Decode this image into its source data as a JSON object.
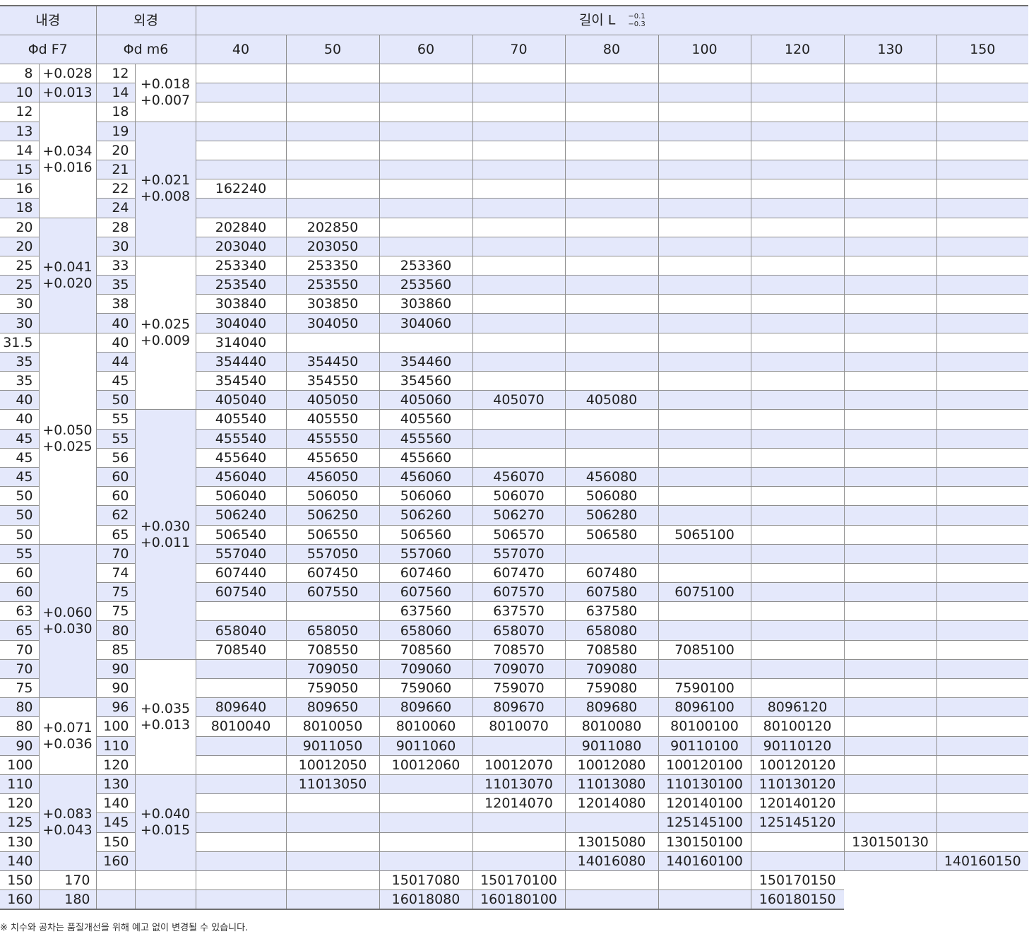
{
  "header": {
    "inner_title": "내경",
    "outer_title": "외경",
    "length_title": "길이 L",
    "length_tol_upper": "−0.1",
    "length_tol_lower": "−0.3",
    "inner_sub": "Φd F7",
    "outer_sub": "Φd m6",
    "lengths": [
      "40",
      "50",
      "60",
      "70",
      "80",
      "100",
      "120",
      "130",
      "150"
    ]
  },
  "inner_tol_groups": [
    {
      "start": 0,
      "span": 1,
      "tol": "+0.028"
    },
    {
      "start": 1,
      "span": 1,
      "tol": "+0.013"
    },
    {
      "start": 2,
      "span": 6,
      "tol": "+0.034\n+0.016"
    },
    {
      "start": 8,
      "span": 6,
      "tol": "+0.041\n+0.020"
    },
    {
      "start": 14,
      "span": 11,
      "tol": "+0.050\n+0.025"
    },
    {
      "start": 25,
      "span": 8,
      "tol": "+0.060\n+0.030"
    },
    {
      "start": 33,
      "span": 4,
      "tol": "+0.071\n+0.036"
    },
    {
      "start": 37,
      "span": 5,
      "tol": "+0.083\n+0.043"
    }
  ],
  "outer_tol_groups": [
    {
      "start": 0,
      "span": 3,
      "tol": "+0.018\n+0.007"
    },
    {
      "start": 3,
      "span": 7,
      "tol": "+0.021\n+0.008"
    },
    {
      "start": 10,
      "span": 8,
      "tol": "+0.025\n+0.009"
    },
    {
      "start": 18,
      "span": 13,
      "tol": "+0.030\n+0.011"
    },
    {
      "start": 31,
      "span": 6,
      "tol": "+0.035\n+0.013"
    },
    {
      "start": 37,
      "span": 5,
      "tol": "+0.040\n+0.015"
    }
  ],
  "rows": [
    {
      "id": "8",
      "od": "12",
      "v": [
        "",
        "",
        "",
        "",
        "",
        "",
        "",
        "",
        ""
      ]
    },
    {
      "id": "10",
      "od": "14",
      "v": [
        "",
        "",
        "",
        "",
        "",
        "",
        "",
        "",
        ""
      ]
    },
    {
      "id": "12",
      "od": "18",
      "v": [
        "",
        "",
        "",
        "",
        "",
        "",
        "",
        "",
        ""
      ]
    },
    {
      "id": "13",
      "od": "19",
      "v": [
        "",
        "",
        "",
        "",
        "",
        "",
        "",
        "",
        ""
      ]
    },
    {
      "id": "14",
      "od": "20",
      "v": [
        "",
        "",
        "",
        "",
        "",
        "",
        "",
        "",
        ""
      ]
    },
    {
      "id": "15",
      "od": "21",
      "v": [
        "",
        "",
        "",
        "",
        "",
        "",
        "",
        "",
        ""
      ]
    },
    {
      "id": "16",
      "od": "22",
      "v": [
        "162240",
        "",
        "",
        "",
        "",
        "",
        "",
        "",
        ""
      ]
    },
    {
      "id": "18",
      "od": "24",
      "v": [
        "",
        "",
        "",
        "",
        "",
        "",
        "",
        "",
        ""
      ]
    },
    {
      "id": "20",
      "od": "28",
      "v": [
        "202840",
        "202850",
        "",
        "",
        "",
        "",
        "",
        "",
        ""
      ]
    },
    {
      "id": "20",
      "od": "30",
      "v": [
        "203040",
        "203050",
        "",
        "",
        "",
        "",
        "",
        "",
        ""
      ]
    },
    {
      "id": "25",
      "od": "33",
      "v": [
        "253340",
        "253350",
        "253360",
        "",
        "",
        "",
        "",
        "",
        ""
      ]
    },
    {
      "id": "25",
      "od": "35",
      "v": [
        "253540",
        "253550",
        "253560",
        "",
        "",
        "",
        "",
        "",
        ""
      ]
    },
    {
      "id": "30",
      "od": "38",
      "v": [
        "303840",
        "303850",
        "303860",
        "",
        "",
        "",
        "",
        "",
        ""
      ]
    },
    {
      "id": "30",
      "od": "40",
      "v": [
        "304040",
        "304050",
        "304060",
        "",
        "",
        "",
        "",
        "",
        ""
      ]
    },
    {
      "id": "31.5",
      "od": "40",
      "v": [
        "314040",
        "",
        "",
        "",
        "",
        "",
        "",
        "",
        ""
      ]
    },
    {
      "id": "35",
      "od": "44",
      "v": [
        "354440",
        "354450",
        "354460",
        "",
        "",
        "",
        "",
        "",
        ""
      ]
    },
    {
      "id": "35",
      "od": "45",
      "v": [
        "354540",
        "354550",
        "354560",
        "",
        "",
        "",
        "",
        "",
        ""
      ]
    },
    {
      "id": "40",
      "od": "50",
      "v": [
        "405040",
        "405050",
        "405060",
        "405070",
        "405080",
        "",
        "",
        "",
        ""
      ]
    },
    {
      "id": "40",
      "od": "55",
      "v": [
        "405540",
        "405550",
        "405560",
        "",
        "",
        "",
        "",
        "",
        ""
      ]
    },
    {
      "id": "45",
      "od": "55",
      "v": [
        "455540",
        "455550",
        "455560",
        "",
        "",
        "",
        "",
        "",
        ""
      ]
    },
    {
      "id": "45",
      "od": "56",
      "v": [
        "455640",
        "455650",
        "455660",
        "",
        "",
        "",
        "",
        "",
        ""
      ]
    },
    {
      "id": "45",
      "od": "60",
      "v": [
        "456040",
        "456050",
        "456060",
        "456070",
        "456080",
        "",
        "",
        "",
        ""
      ]
    },
    {
      "id": "50",
      "od": "60",
      "v": [
        "506040",
        "506050",
        "506060",
        "506070",
        "506080",
        "",
        "",
        "",
        ""
      ]
    },
    {
      "id": "50",
      "od": "62",
      "v": [
        "506240",
        "506250",
        "506260",
        "506270",
        "506280",
        "",
        "",
        "",
        ""
      ]
    },
    {
      "id": "50",
      "od": "65",
      "v": [
        "506540",
        "506550",
        "506560",
        "506570",
        "506580",
        "5065100",
        "",
        "",
        ""
      ]
    },
    {
      "id": "55",
      "od": "70",
      "v": [
        "557040",
        "557050",
        "557060",
        "557070",
        "",
        "",
        "",
        "",
        ""
      ]
    },
    {
      "id": "60",
      "od": "74",
      "v": [
        "607440",
        "607450",
        "607460",
        "607470",
        "607480",
        "",
        "",
        "",
        ""
      ]
    },
    {
      "id": "60",
      "od": "75",
      "v": [
        "607540",
        "607550",
        "607560",
        "607570",
        "607580",
        "6075100",
        "",
        "",
        ""
      ]
    },
    {
      "id": "63",
      "od": "75",
      "v": [
        "",
        "",
        "637560",
        "637570",
        "637580",
        "",
        "",
        "",
        ""
      ]
    },
    {
      "id": "65",
      "od": "80",
      "v": [
        "658040",
        "658050",
        "658060",
        "658070",
        "658080",
        "",
        "",
        "",
        ""
      ]
    },
    {
      "id": "70",
      "od": "85",
      "v": [
        "708540",
        "708550",
        "708560",
        "708570",
        "708580",
        "7085100",
        "",
        "",
        ""
      ]
    },
    {
      "id": "70",
      "od": "90",
      "v": [
        "",
        "709050",
        "709060",
        "709070",
        "709080",
        "",
        "",
        "",
        ""
      ]
    },
    {
      "id": "75",
      "od": "90",
      "v": [
        "",
        "759050",
        "759060",
        "759070",
        "759080",
        "7590100",
        "",
        "",
        ""
      ]
    },
    {
      "id": "80",
      "od": "96",
      "v": [
        "809640",
        "809650",
        "809660",
        "809670",
        "809680",
        "8096100",
        "8096120",
        "",
        ""
      ]
    },
    {
      "id": "80",
      "od": "100",
      "v": [
        "8010040",
        "8010050",
        "8010060",
        "8010070",
        "8010080",
        "80100100",
        "80100120",
        "",
        ""
      ]
    },
    {
      "id": "90",
      "od": "110",
      "v": [
        "",
        "9011050",
        "9011060",
        "",
        "9011080",
        "90110100",
        "90110120",
        "",
        ""
      ]
    },
    {
      "id": "100",
      "od": "120",
      "v": [
        "",
        "10012050",
        "10012060",
        "10012070",
        "10012080",
        "100120100",
        "100120120",
        "",
        ""
      ]
    },
    {
      "id": "110",
      "od": "130",
      "v": [
        "",
        "11013050",
        "",
        "11013070",
        "11013080",
        "110130100",
        "110130120",
        "",
        ""
      ]
    },
    {
      "id": "120",
      "od": "140",
      "v": [
        "",
        "",
        "",
        "12014070",
        "12014080",
        "120140100",
        "120140120",
        "",
        ""
      ]
    },
    {
      "id": "125",
      "od": "145",
      "v": [
        "",
        "",
        "",
        "",
        "",
        "125145100",
        "125145120",
        "",
        ""
      ]
    },
    {
      "id": "130",
      "od": "150",
      "v": [
        "",
        "",
        "",
        "",
        "13015080",
        "130150100",
        "",
        "130150130",
        ""
      ]
    },
    {
      "id": "140",
      "od": "160",
      "v": [
        "",
        "",
        "",
        "",
        "14016080",
        "140160100",
        "",
        "",
        "140160150"
      ]
    },
    {
      "id": "150",
      "od": "170",
      "v": [
        "",
        "",
        "",
        "",
        "15017080",
        "150170100",
        "",
        "",
        "150170150"
      ]
    },
    {
      "id": "160",
      "od": "180",
      "v": [
        "",
        "",
        "",
        "",
        "16018080",
        "160180100",
        "",
        "",
        "160180150"
      ]
    }
  ],
  "footnote": "※ 치수와 공차는 품질개선을 위해 예고 없이 변경될 수 있습니다."
}
